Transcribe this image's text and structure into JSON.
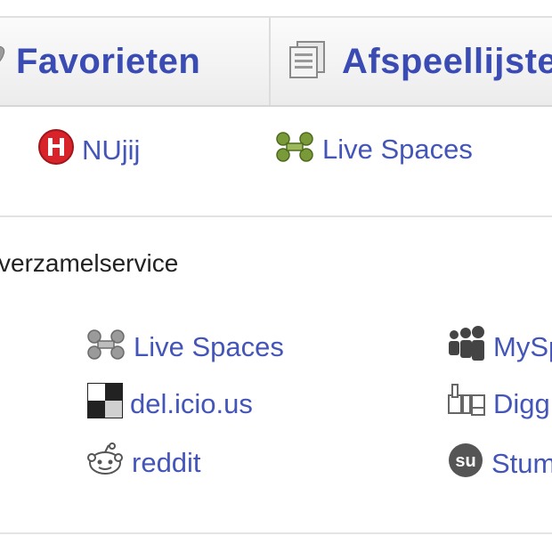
{
  "tabs": [
    {
      "label": "Favorieten",
      "icon": "heart-icon"
    },
    {
      "label": "Afspeellijsten",
      "icon": "playlist-icon"
    }
  ],
  "share_row": [
    {
      "label": "NUjij",
      "icon": "nujij-icon"
    },
    {
      "label": "Live Spaces",
      "icon": "live-spaces-icon"
    }
  ],
  "bookmark_section": {
    "title": "verzamelservice",
    "links": [
      {
        "label": "Live Spaces",
        "icon": "live-spaces-icon"
      },
      {
        "label": "del.icio.us",
        "icon": "delicious-icon"
      },
      {
        "label": "reddit",
        "icon": "reddit-icon"
      },
      {
        "label": "MySp",
        "icon": "myspace-icon"
      },
      {
        "label": "Digg",
        "icon": "digg-icon"
      },
      {
        "label": "Stum",
        "icon": "stumbleupon-icon"
      }
    ]
  },
  "colors": {
    "link": "#4455b8",
    "tab_label": "#3a4bb3"
  }
}
